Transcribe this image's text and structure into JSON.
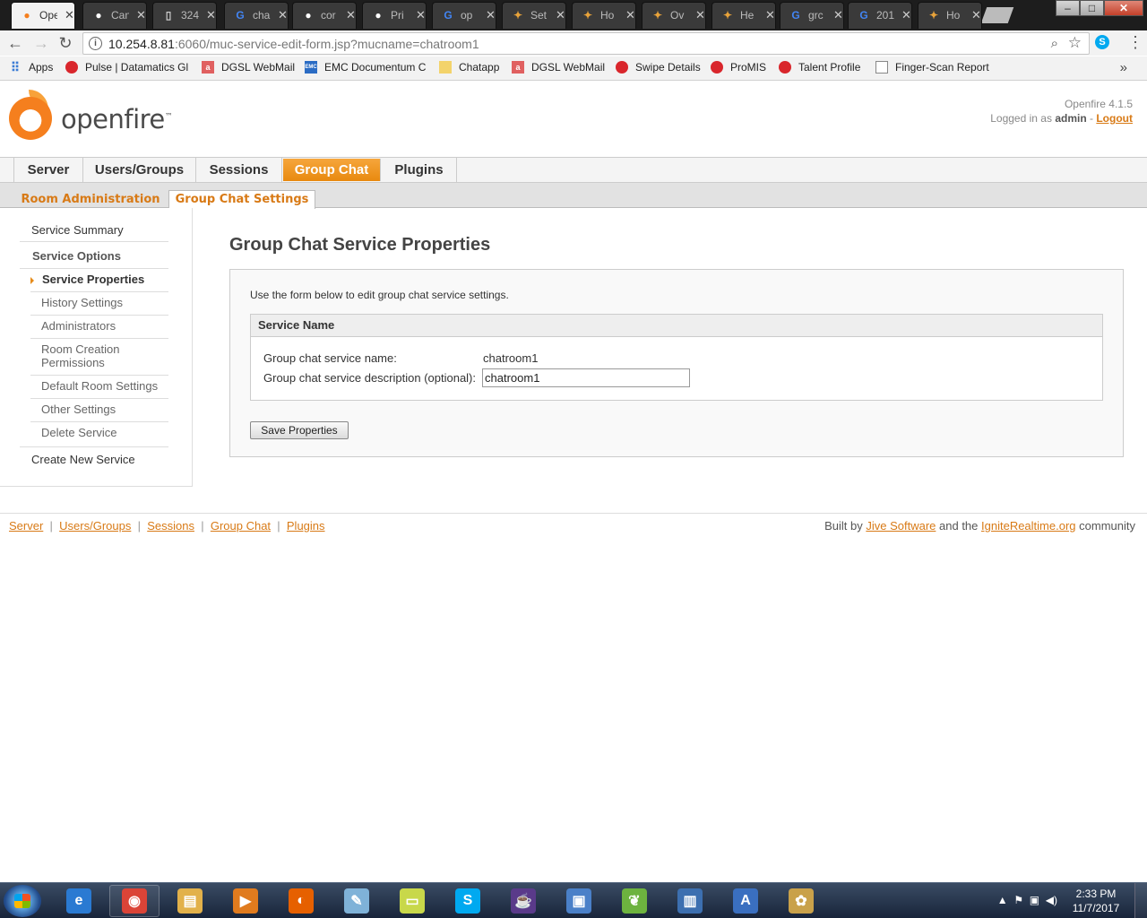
{
  "browser": {
    "tabs": [
      {
        "title": "Openfire",
        "favicon": "openfire-icon",
        "fav_glyph": "●",
        "fav_color": "#f57f1e",
        "active": true
      },
      {
        "title": "Can",
        "favicon": "github-icon",
        "fav_glyph": "●",
        "fav_color": "#ffffff"
      },
      {
        "title": "324",
        "favicon": "page-icon",
        "fav_glyph": "▯",
        "fav_color": "#cccccc"
      },
      {
        "title": "cha",
        "favicon": "google-icon",
        "fav_glyph": "G",
        "fav_color": "#4285f4"
      },
      {
        "title": "cor",
        "favicon": "github-icon",
        "fav_glyph": "●",
        "fav_color": "#ffffff"
      },
      {
        "title": "Pri",
        "favicon": "github-icon",
        "fav_glyph": "●",
        "fav_color": "#ffffff"
      },
      {
        "title": "op",
        "favicon": "google-icon",
        "fav_glyph": "G",
        "fav_color": "#4285f4"
      },
      {
        "title": "Set",
        "favicon": "ignite-icon",
        "fav_glyph": "✦",
        "fav_color": "#e8a33a"
      },
      {
        "title": "Ho",
        "favicon": "ignite-icon",
        "fav_glyph": "✦",
        "fav_color": "#e8a33a"
      },
      {
        "title": "Ov",
        "favicon": "ignite-icon",
        "fav_glyph": "✦",
        "fav_color": "#e8a33a"
      },
      {
        "title": "He",
        "favicon": "ignite-icon",
        "fav_glyph": "✦",
        "fav_color": "#e8a33a"
      },
      {
        "title": "grc",
        "favicon": "google-icon",
        "fav_glyph": "G",
        "fav_color": "#4285f4"
      },
      {
        "title": "201",
        "favicon": "google-icon",
        "fav_glyph": "G",
        "fav_color": "#4285f4"
      },
      {
        "title": "Ho",
        "favicon": "ignite-icon",
        "fav_glyph": "✦",
        "fav_color": "#e8a33a"
      }
    ],
    "url_host": "10.254.8.81",
    "url_rest": ":6060/muc-service-edit-form.jsp?mucname=chatroom1",
    "bookmarks": [
      {
        "label": "Apps",
        "icon": "apps-grid-icon",
        "glyph": "⠿",
        "cls": "grid"
      },
      {
        "label": "Pulse | Datamatics Gl",
        "icon": "datamatics-icon",
        "glyph": "",
        "cls": "red"
      },
      {
        "label": "DGSL WebMail",
        "icon": "webmail-icon",
        "glyph": "a",
        "cls": "sq"
      },
      {
        "label": "EMC Documentum C",
        "icon": "emc-icon",
        "glyph": "EMC",
        "cls": "emc"
      },
      {
        "label": "Chatapp",
        "icon": "folder-icon",
        "glyph": "",
        "cls": "folder"
      },
      {
        "label": "DGSL WebMail",
        "icon": "webmail-icon",
        "glyph": "a",
        "cls": "sq"
      },
      {
        "label": "Swipe Details",
        "icon": "datamatics-icon",
        "glyph": "",
        "cls": "red"
      },
      {
        "label": "ProMIS",
        "icon": "datamatics-icon",
        "glyph": "",
        "cls": "red"
      },
      {
        "label": "Talent Profile",
        "icon": "datamatics-icon",
        "glyph": "",
        "cls": "red"
      },
      {
        "label": "Finger-Scan Report",
        "icon": "page-icon",
        "glyph": "",
        "cls": "doc"
      }
    ]
  },
  "header": {
    "logo_text": "openfire",
    "version": "Openfire 4.1.5",
    "logged_in_prefix": "Logged in as",
    "user": "admin",
    "separator": "-",
    "logout": "Logout"
  },
  "main_tabs": [
    {
      "label": "Server",
      "active": false
    },
    {
      "label": "Users/Groups",
      "active": false
    },
    {
      "label": "Sessions",
      "active": false
    },
    {
      "label": "Group Chat",
      "active": true
    },
    {
      "label": "Plugins",
      "active": false
    }
  ],
  "sub_tabs": [
    {
      "label": "Room Administration",
      "active": false
    },
    {
      "label": "Group Chat Settings",
      "active": true
    }
  ],
  "sidebar": {
    "service_summary": "Service Summary",
    "service_options": "Service Options",
    "service_properties": "Service Properties",
    "history_settings": "History Settings",
    "administrators": "Administrators",
    "room_creation_1": "Room Creation",
    "room_creation_2": "Permissions",
    "default_room_settings": "Default Room Settings",
    "other_settings": "Other Settings",
    "delete_service": "Delete Service",
    "create_new_service": "Create New Service"
  },
  "main": {
    "title": "Group Chat Service Properties",
    "intro": "Use the form below to edit group chat service settings.",
    "fieldset_title": "Service Name",
    "name_label": "Group chat service name:",
    "name_value": "chatroom1",
    "desc_label": "Group chat service description (optional):",
    "desc_value": "chatroom1",
    "save_button": "Save Properties"
  },
  "footer": {
    "links": [
      "Server",
      "Users/Groups",
      "Sessions",
      "Group Chat",
      "Plugins"
    ],
    "separator": "|",
    "built_by": "Built by",
    "jive": "Jive Software",
    "and_the": "and the",
    "ignite": "IgniteRealtime.org",
    "community": "community"
  },
  "taskbar": {
    "apps": [
      {
        "name": "ie-icon",
        "glyph": "e",
        "color": "#2a7ad2",
        "pinned": false
      },
      {
        "name": "chrome-icon",
        "glyph": "◉",
        "color": "#db4437",
        "pinned": true
      },
      {
        "name": "explorer-icon",
        "glyph": "▤",
        "color": "#e2b14a",
        "pinned": false
      },
      {
        "name": "media-player-icon",
        "glyph": "▶",
        "color": "#e07b1e",
        "pinned": false
      },
      {
        "name": "firefox-icon",
        "glyph": "◐",
        "color": "#e66000",
        "pinned": false
      },
      {
        "name": "notepad-icon",
        "glyph": "✎",
        "color": "#7fb2d8",
        "pinned": false
      },
      {
        "name": "sticky-notes-icon",
        "glyph": "▭",
        "color": "#c8d84a",
        "pinned": false
      },
      {
        "name": "skype-icon",
        "glyph": "S",
        "color": "#00a9f0",
        "pinned": false
      },
      {
        "name": "java-ee-ide-icon",
        "glyph": "☕",
        "color": "#5a3a8a",
        "pinned": false
      },
      {
        "name": "virtualbox-icon",
        "glyph": "▣",
        "color": "#4a80c8",
        "pinned": false
      },
      {
        "name": "spring-icon",
        "glyph": "❦",
        "color": "#6db33f",
        "pinned": false
      },
      {
        "name": "remote-desktop-icon",
        "glyph": "▥",
        "color": "#3c6fb0",
        "pinned": false
      },
      {
        "name": "wordpad-icon",
        "glyph": "A",
        "color": "#3a6fc0",
        "pinned": false
      },
      {
        "name": "paint-icon",
        "glyph": "✿",
        "color": "#c9a14a",
        "pinned": false
      }
    ],
    "time": "2:33 PM",
    "date": "11/7/2017"
  }
}
